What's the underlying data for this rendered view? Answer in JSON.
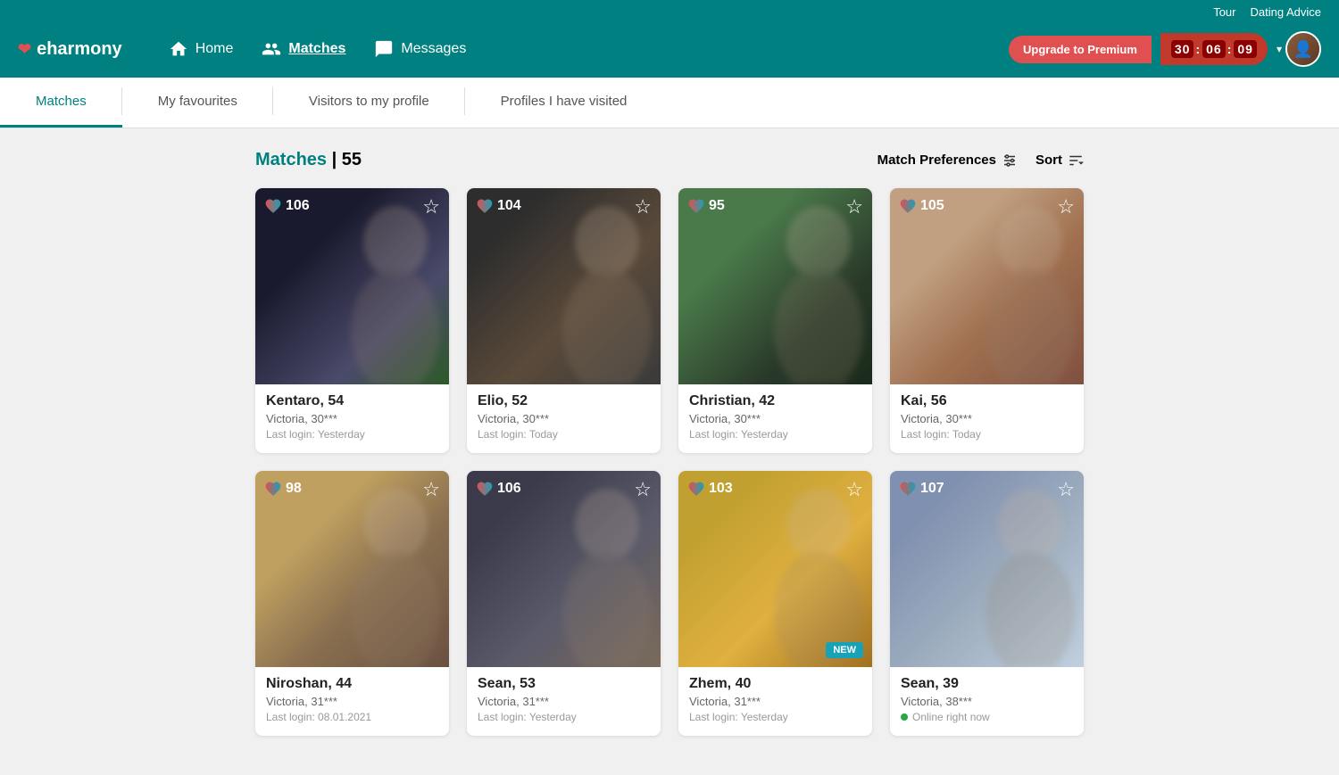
{
  "topLinks": [
    "Tour",
    "Dating Advice"
  ],
  "logo": {
    "icon": "❤",
    "text": "eharmony"
  },
  "nav": {
    "items": [
      {
        "label": "Home",
        "icon": "home"
      },
      {
        "label": "Matches",
        "icon": "matches"
      },
      {
        "label": "Messages",
        "icon": "messages"
      }
    ]
  },
  "upgradeBtn": "Upgrade to Premium",
  "timer": "30:06:09",
  "subNav": {
    "items": [
      {
        "label": "Matches",
        "active": true
      },
      {
        "label": "My favourites",
        "active": false
      },
      {
        "label": "Visitors to my profile",
        "active": false
      },
      {
        "label": "Profiles I have visited",
        "active": false
      }
    ]
  },
  "matchesTitle": "Matches",
  "matchesCount": "55",
  "matchPrefsLabel": "Match Preferences",
  "sortLabel": "Sort",
  "cards": [
    {
      "score": 106,
      "name": "Kentaro, 54",
      "location": "Victoria, 30***",
      "lastLogin": "Last login: Yesterday",
      "isNew": false,
      "isOnline": false,
      "bgClass": "bg-1"
    },
    {
      "score": 104,
      "name": "Elio, 52",
      "location": "Victoria, 30***",
      "lastLogin": "Last login: Today",
      "isNew": false,
      "isOnline": false,
      "bgClass": "bg-2"
    },
    {
      "score": 95,
      "name": "Christian, 42",
      "location": "Victoria, 30***",
      "lastLogin": "Last login: Yesterday",
      "isNew": false,
      "isOnline": false,
      "bgClass": "bg-3"
    },
    {
      "score": 105,
      "name": "Kai, 56",
      "location": "Victoria, 30***",
      "lastLogin": "Last login: Today",
      "isNew": false,
      "isOnline": false,
      "bgClass": "bg-4"
    },
    {
      "score": 98,
      "name": "Niroshan, 44",
      "location": "Victoria, 31***",
      "lastLogin": "Last login: 08.01.2021",
      "isNew": false,
      "isOnline": false,
      "bgClass": "bg-5"
    },
    {
      "score": 106,
      "name": "Sean, 53",
      "location": "Victoria, 31***",
      "lastLogin": "Last login: Yesterday",
      "isNew": false,
      "isOnline": false,
      "bgClass": "bg-6"
    },
    {
      "score": 103,
      "name": "Zhem, 40",
      "location": "Victoria, 31***",
      "lastLogin": "Last login: Yesterday",
      "isNew": true,
      "isOnline": false,
      "bgClass": "bg-7"
    },
    {
      "score": 107,
      "name": "Sean, 39",
      "location": "Victoria, 38***",
      "lastLogin": "Online right now",
      "isNew": false,
      "isOnline": true,
      "bgClass": "bg-8"
    }
  ],
  "newBadgeLabel": "NEW"
}
